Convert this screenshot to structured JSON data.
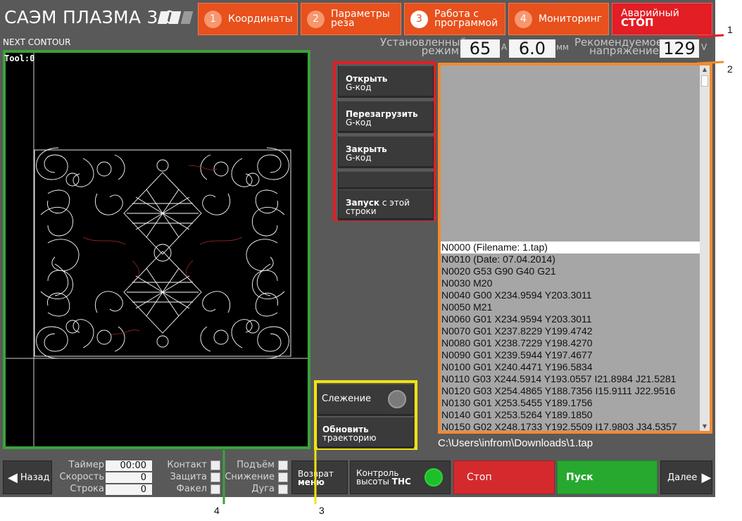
{
  "app": {
    "title": "САЭМ ПЛАЗМА 3.0"
  },
  "tabs": [
    {
      "num": "1",
      "line1": "Координаты",
      "line2": ""
    },
    {
      "num": "2",
      "line1": "Параметры",
      "line2": "реза"
    },
    {
      "num": "3",
      "line1": "Работа с",
      "line2": "программой"
    },
    {
      "num": "4",
      "line1": "Мониторинг",
      "line2": ""
    }
  ],
  "estop": {
    "line1": "Аварийный",
    "line2": "СТОП"
  },
  "status": {
    "next_contour": "NEXT CONTOUR",
    "mode_label_1": "Установленный",
    "mode_label_2": "режим",
    "current": "65",
    "current_unit": "A",
    "thickness": "6.0",
    "thickness_unit": "мм",
    "voltage_label_1": "Рекомендуемое",
    "voltage_label_2": "напряжение",
    "voltage": "129",
    "voltage_unit": "V"
  },
  "canvas": {
    "tool_label": "Tool:0"
  },
  "file_buttons": [
    {
      "bold": "Открыть",
      "sub": "G-код"
    },
    {
      "bold": "Перезагрузить",
      "sub": "G-код"
    },
    {
      "bold": "Закрыть",
      "sub": "G-код"
    }
  ],
  "run_from_line": {
    "bold": "Запуск",
    "rest": " с этой",
    "line2": "строки"
  },
  "gcode_lines": [
    "N0000 (Filename: 1.tap)",
    "N0010 (Date: 07.04.2014)",
    "N0020 G53 G90 G40 G21",
    "N0030 M20",
    "N0040  G00 X234.9594 Y203.3011",
    "N0050 M21",
    "N0060 G01 X234.9594 Y203.3011",
    "N0070 G01 X237.8229 Y199.4742",
    "N0080 G01 X238.7229 Y198.4270",
    "N0090 G01 X239.5944 Y197.4677",
    "N0100 G01 X240.4471 Y196.5834",
    "N0110 G03 X244.5914 Y193.0557 I21.8984 J21.5281",
    "N0120 G03 X254.4865 Y188.7356 I15.9111 J22.9516",
    "N0130 G01 X253.5455 Y189.1756",
    "N0140 G01 X253.5264 Y189.1850",
    "N0150 G02 X248.1733 Y192.5509 I17.9803 J34.5357"
  ],
  "file_path": "C:\\Users\\infrom\\Downloads\\1.tap",
  "tracking": {
    "label": "Слежение"
  },
  "refresh_path": {
    "bold": "Обновить",
    "sub": "траекторию"
  },
  "bottom": {
    "back": "Назад",
    "timer_label": "Таймер",
    "timer_value": "00:00",
    "speed_label": "Скорость",
    "speed_value": "0",
    "line_label": "Строка",
    "line_value": "0",
    "contact": "Контакт",
    "protection": "Защита",
    "torch": "Факел",
    "lift": "Подъём",
    "lower": "Снижение",
    "arc": "Дуга",
    "return_line1": "Возврат",
    "return_line2": "меню",
    "thc_line1": "Контроль",
    "thc_line2": "высоты",
    "thc_bold": "THC",
    "stop": "Стоп",
    "start": "Пуск",
    "next": "Далее"
  },
  "callouts": [
    "1",
    "2",
    "3",
    "4"
  ],
  "colors": {
    "tab_orange": "#e8501c",
    "estop_red": "#e31e24",
    "stop_red": "#d42a2e",
    "start_green": "#27a82f",
    "thc_led": "#1ec02a",
    "frame_green": "#3aa33a",
    "frame_red": "#e31e24",
    "frame_orange": "#f28a2e",
    "frame_yellow": "#f2e20f"
  }
}
